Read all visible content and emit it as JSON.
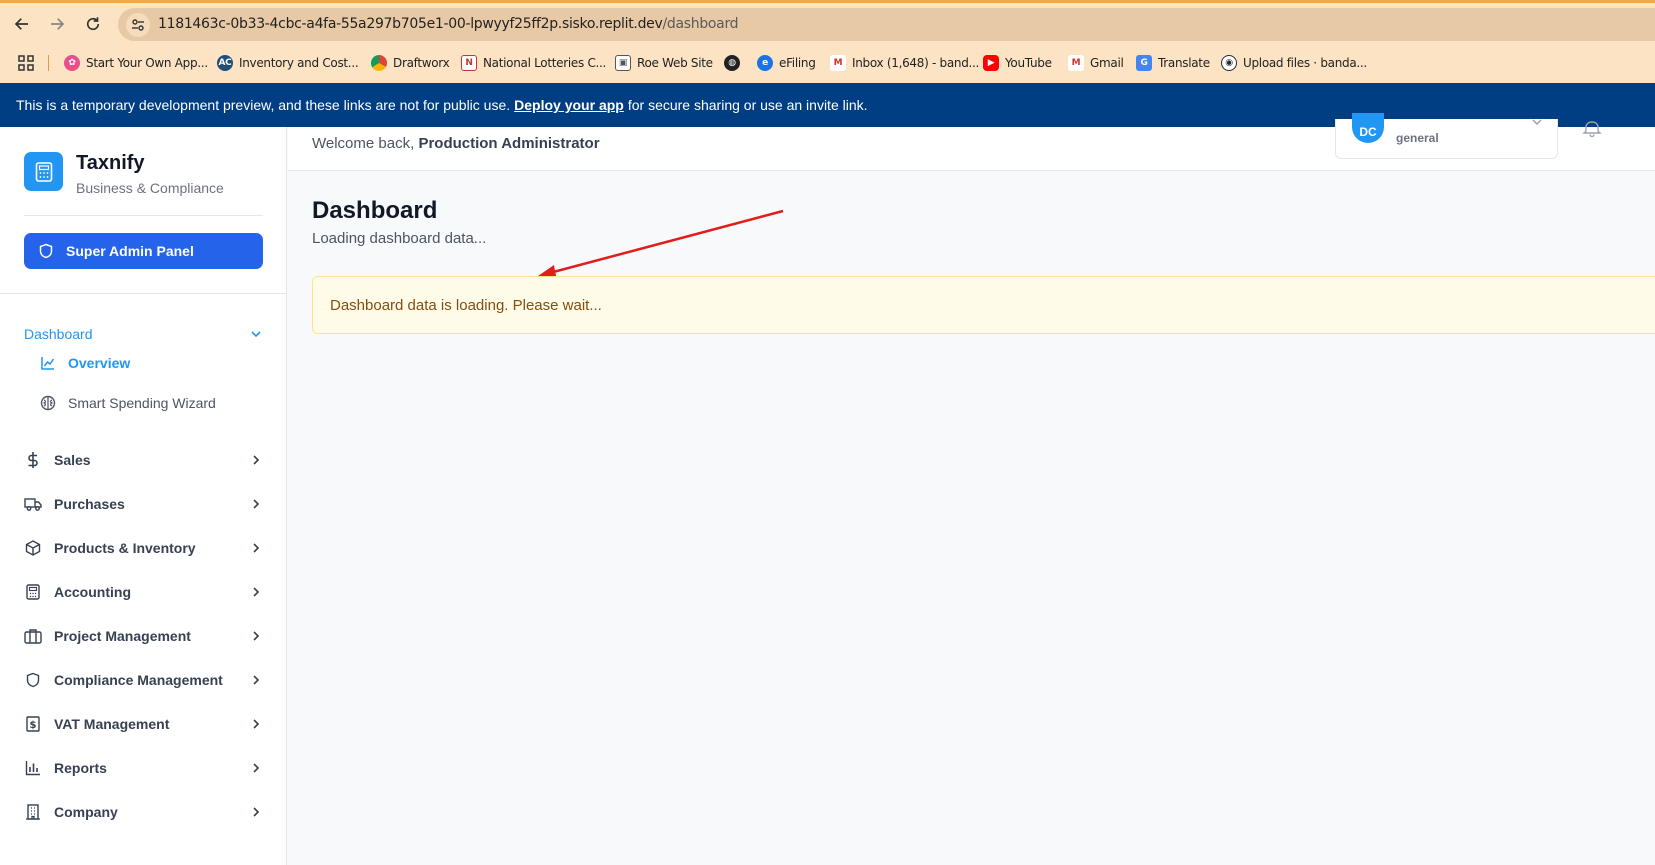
{
  "browser": {
    "url_host": "1181463c-0b33-4cbc-a4fa-55a297b705e1-00-lpwyyf25ff2p.sisko.replit.dev",
    "url_path": "/dashboard",
    "bookmarks": [
      {
        "label": "Start Your Own App...",
        "icon": "app-icon",
        "color": "#e84f8b"
      },
      {
        "label": "Inventory and Cost...",
        "icon": "ac-icon",
        "color": "#1f4e79"
      },
      {
        "label": "Draftworx",
        "icon": "chrome-icon",
        "color": "#db4437"
      },
      {
        "label": "National Lotteries C...",
        "icon": "nlc-icon",
        "color": "#c0392b"
      },
      {
        "label": "Roe Web Site",
        "icon": "image-icon",
        "color": "#555555"
      },
      {
        "label": "",
        "icon": "globe-icon",
        "color": "#222222"
      },
      {
        "label": "eFiling",
        "icon": "efiling-icon",
        "color": "#1a73e8"
      },
      {
        "label": "Inbox (1,648) - band...",
        "icon": "gmail-icon",
        "color": "#d93025"
      },
      {
        "label": "YouTube",
        "icon": "youtube-icon",
        "color": "#ff0000"
      },
      {
        "label": "Gmail",
        "icon": "gmail-icon",
        "color": "#d93025"
      },
      {
        "label": "Translate",
        "icon": "translate-icon",
        "color": "#4285f4"
      },
      {
        "label": "Upload files · banda...",
        "icon": "github-icon",
        "color": "#24292f"
      }
    ]
  },
  "dev_banner": {
    "text_before": "This is a temporary development preview, and these links are not for public use.",
    "link": "Deploy your app",
    "text_after": "for secure sharing or use an invite link."
  },
  "sidebar": {
    "brand_name": "Taxnify",
    "brand_sub": "Business & Compliance",
    "super_admin_label": "Super Admin Panel",
    "dashboard_label": "Dashboard",
    "sub_items": [
      {
        "label": "Overview",
        "icon": "chart-line-icon"
      },
      {
        "label": "Smart Spending Wizard",
        "icon": "brain-icon"
      }
    ],
    "items": [
      {
        "label": "Sales",
        "icon": "dollar-icon"
      },
      {
        "label": "Purchases",
        "icon": "truck-icon"
      },
      {
        "label": "Products & Inventory",
        "icon": "package-icon"
      },
      {
        "label": "Accounting",
        "icon": "calculator-icon"
      },
      {
        "label": "Project Management",
        "icon": "briefcase-icon"
      },
      {
        "label": "Compliance Management",
        "icon": "shield-icon"
      },
      {
        "label": "VAT Management",
        "icon": "receipt-icon"
      },
      {
        "label": "Reports",
        "icon": "bar-chart-icon"
      },
      {
        "label": "Company",
        "icon": "building-icon"
      }
    ]
  },
  "header": {
    "welcome_prefix": "Welcome back,",
    "welcome_name": "Production Administrator",
    "user_initials": "DC",
    "user_role": "general"
  },
  "main": {
    "title": "Dashboard",
    "subtitle": "Loading dashboard data...",
    "alert": "Dashboard data is loading. Please wait..."
  },
  "colors": {
    "accent": "#2196f3",
    "primary_button": "#2563eb",
    "banner": "#003e83",
    "alert_bg": "#fefce8",
    "alert_text": "#854d0e",
    "annotation_arrow": "#e11d1d"
  }
}
